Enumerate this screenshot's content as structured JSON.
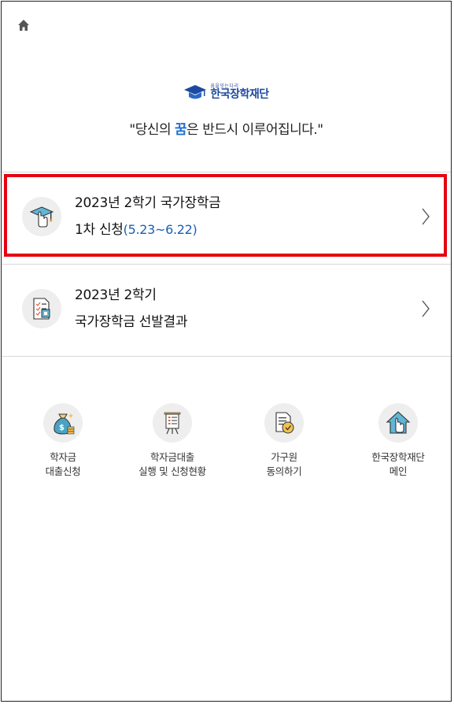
{
  "header": {
    "home_icon": "home-icon"
  },
  "brand": {
    "logo_small": "꿈을잇는다리",
    "logo_name": "한국장학재단",
    "slogan_before": "\"당신의 ",
    "slogan_accent": "꿈",
    "slogan_after": "은 반드시 이루어집니다.\"",
    "accent_color": "#1f6fd1"
  },
  "menu": [
    {
      "line1": "2023년 2학기 국가장학금",
      "line2_main": "1차 신청",
      "line2_period": "(5.23~6.22)",
      "icon": "graduation-hand-icon",
      "highlighted": true
    },
    {
      "line1": "2023년 2학기",
      "line2_main": "국가장학금 선발결과",
      "line2_period": "",
      "icon": "result-document-icon",
      "highlighted": false
    }
  ],
  "quick_links": [
    {
      "line1": "학자금",
      "line2": "대출신청",
      "icon": "money-bag-icon"
    },
    {
      "line1": "학자금대출",
      "line2": "실행 및 신청현황",
      "icon": "presentation-board-icon"
    },
    {
      "line1": "가구원",
      "line2": "동의하기",
      "icon": "consent-document-icon"
    },
    {
      "line1": "한국장학재단",
      "line2": "메인",
      "icon": "house-hand-icon"
    }
  ],
  "highlight_color": "#e60012"
}
